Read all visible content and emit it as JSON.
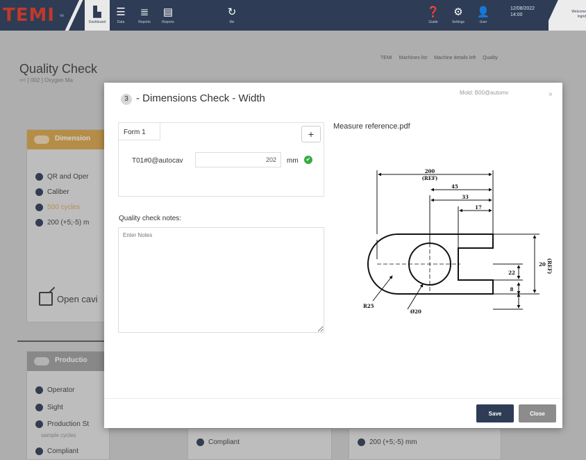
{
  "topbar": {
    "logo_text": "TEMI",
    "logo_plus": "+",
    "nav": [
      {
        "icon": "chart-icon",
        "glyph": "▙",
        "caption": "Dashboard"
      },
      {
        "icon": "database-icon",
        "glyph": "☰",
        "caption": "Data"
      },
      {
        "icon": "reports-icon",
        "glyph": "≣",
        "caption": "Reports"
      },
      {
        "icon": "document-icon",
        "glyph": "▤",
        "caption": "Reports"
      },
      {
        "icon": "refresh-icon",
        "glyph": "↻",
        "caption": "Me"
      }
    ],
    "right_nav": [
      {
        "icon": "help-icon",
        "glyph": "❓",
        "caption": "Guide"
      },
      {
        "icon": "gear-icon",
        "glyph": "⚙",
        "caption": "Settings"
      },
      {
        "icon": "user-icon",
        "glyph": "👤",
        "caption": "User"
      }
    ],
    "date": "12/08/2022",
    "time": "14:00",
    "user_line1": "Welcome",
    "user_line2": "Ingrid"
  },
  "page": {
    "title": "Quality Check",
    "subtitle": "<< [ 002 ] Oxygen Ma",
    "breadcrumbs": [
      "TEMI",
      "Machines list",
      "Machine details left",
      "Quality"
    ]
  },
  "bg_cards": {
    "dimensions_header": "Dimension",
    "dimensions_rows": [
      "QR and Oper",
      "Caliber",
      "500 cycles",
      "200 (+5;-5) m"
    ],
    "open_cavity": "Open cavi",
    "production_header": "Productio",
    "production_rows": [
      "Operator",
      "Sight",
      "Production St",
      "sample cycles",
      "Compliant"
    ],
    "mid_row": "Compliant",
    "right_row": "200 (+5;-5) mm"
  },
  "modal": {
    "step": "3",
    "title": "- Dimensions Check - Width",
    "mold": "Mold: B00@automv",
    "close_x": "×",
    "form_tab": "Form 1",
    "add_label": "+",
    "field_label": "T01#0@autocav",
    "field_value": "202",
    "field_unit": "mm",
    "ok_glyph": "✔",
    "notes_label": "Quality check notes:",
    "notes_placeholder": "Enter Notes",
    "reference_title": "Measure reference.pdf",
    "save_label": "Save",
    "close_label": "Close"
  },
  "drawing": {
    "dim_200": "200",
    "dim_ref": "(REF)",
    "dim_45": "45",
    "dim_33": "33",
    "dim_17": "17",
    "dim_20": "20",
    "dim_22": "22",
    "dim_8": "8",
    "dim_right_ref": "(REF)",
    "label_r25": "R25",
    "label_d20": "Ø20"
  }
}
